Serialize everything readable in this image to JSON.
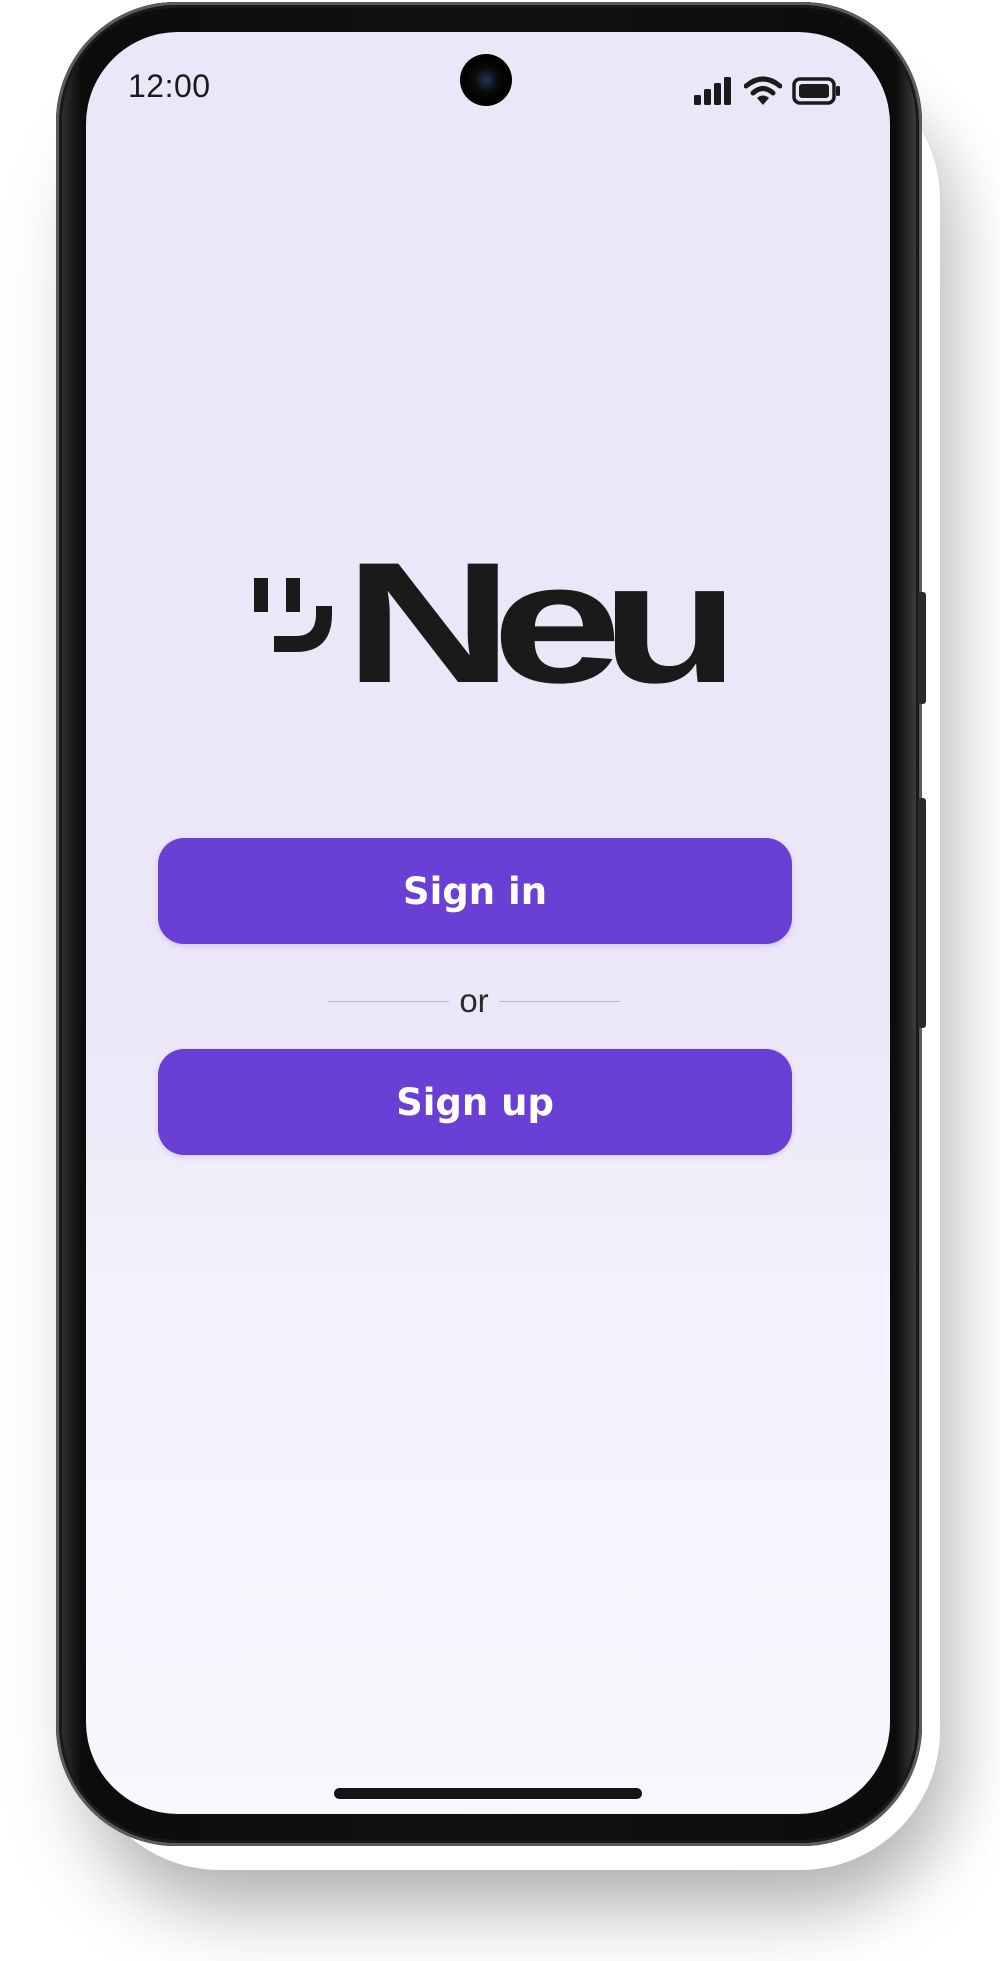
{
  "status_bar": {
    "time": "12:00",
    "icons": [
      "signal-icon",
      "wifi-icon",
      "battery-icon"
    ]
  },
  "brand": {
    "name": "Neu",
    "logo_mark": "smile-icon",
    "color": "#1a1a1a"
  },
  "auth": {
    "sign_in_label": "Sign in",
    "divider_label": "or",
    "sign_up_label": "Sign up"
  },
  "theme": {
    "accent": "#6a3fd6",
    "background": "#ebe7f8"
  }
}
